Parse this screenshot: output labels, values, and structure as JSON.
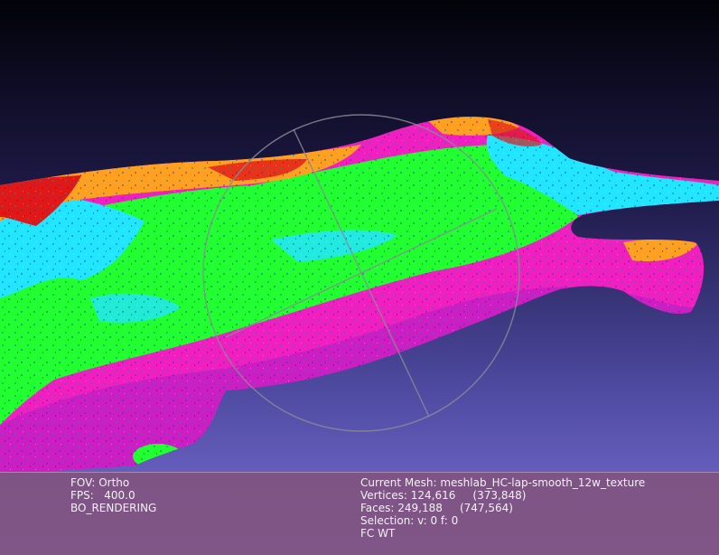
{
  "colors": {
    "bg_top": "#020208",
    "bg_bottom": "#7b72d6",
    "info_bar": "#805480",
    "info_text": "#f2f2f2",
    "mesh_magenta": "#f020c0",
    "mesh_green": "#20ff30",
    "mesh_cyan": "#20e8ff",
    "mesh_orange": "#ffa020",
    "mesh_red": "#e01818",
    "trackball": "#8a8a96"
  },
  "info": {
    "left": {
      "fov": "FOV: Ortho",
      "fps": "FPS:   400.0",
      "rendering": "BO_RENDERING"
    },
    "right": {
      "current_mesh": "Current Mesh: meshlab_HC-lap-smooth_12w_texture",
      "vertices": "Vertices: 124,616     (373,848)",
      "faces": "Faces: 249,188     (747,564)",
      "selection": "Selection: v: 0 f: 0",
      "fc": "FC WT"
    }
  },
  "viewport": {
    "object": "textured 3D mesh",
    "trackball": "trackball gizmo"
  }
}
